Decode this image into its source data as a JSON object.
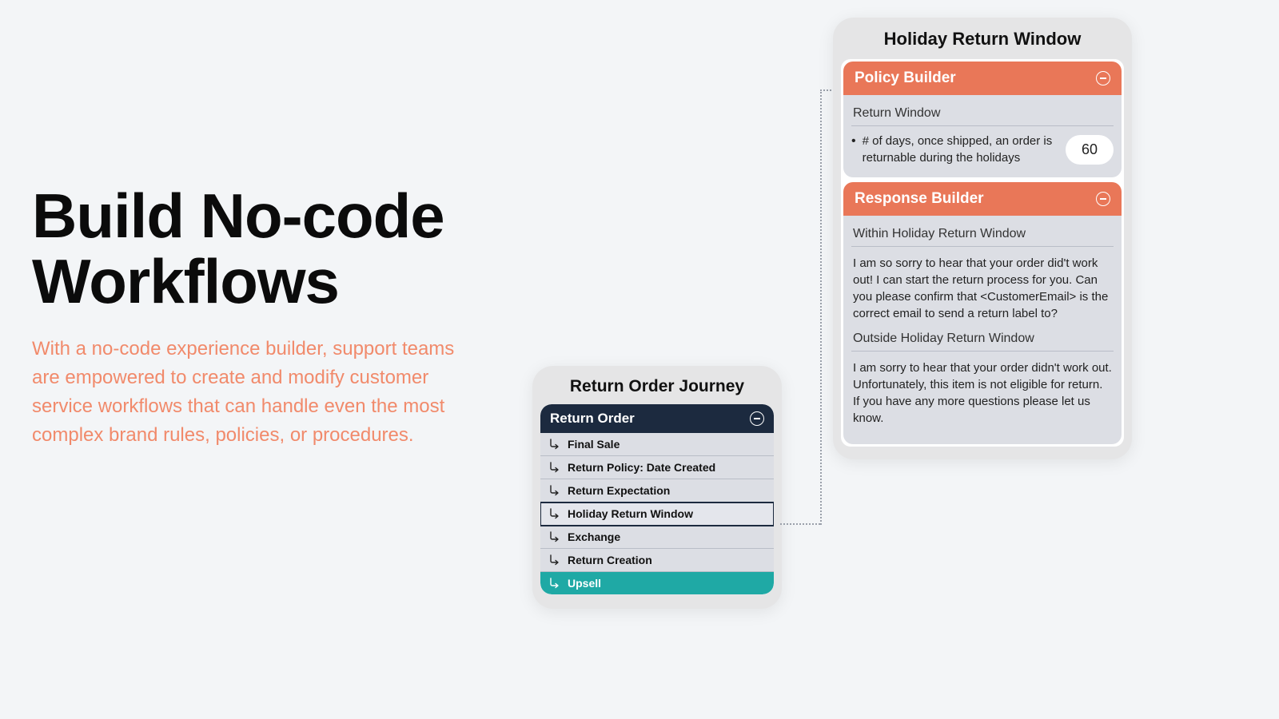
{
  "hero": {
    "headline": "Build No-code Workflows",
    "subtext": "With a no-code experience builder, support teams are empowered to create and modify customer service workflows that can handle even the most complex brand rules, policies, or procedures."
  },
  "journey": {
    "title": "Return Order Journey",
    "header": "Return Order",
    "items": [
      "Final Sale",
      "Return Policy: Date Created",
      "Return Expectation",
      "Holiday Return Window",
      "Exchange",
      "Return Creation",
      "Upsell"
    ]
  },
  "detail": {
    "title": "Holiday Return Window",
    "policy": {
      "header": "Policy Builder",
      "section": "Return Window",
      "bullet": "# of days, once shipped, an order is returnable during the holidays",
      "value": "60"
    },
    "response": {
      "header": "Response Builder",
      "within_title": "Within Holiday Return Window",
      "within_text": "I am so sorry to hear that your order did't work out! I can start the return process for you. Can you please confirm that <CustomerEmail> is the correct email to send a return label to?",
      "outside_title": "Outside Holiday Return Window",
      "outside_text": "I am sorry to hear that your order didn't work out.  Unfortunately, this item is not eligible for return. If you have any more questions please let us know."
    }
  }
}
